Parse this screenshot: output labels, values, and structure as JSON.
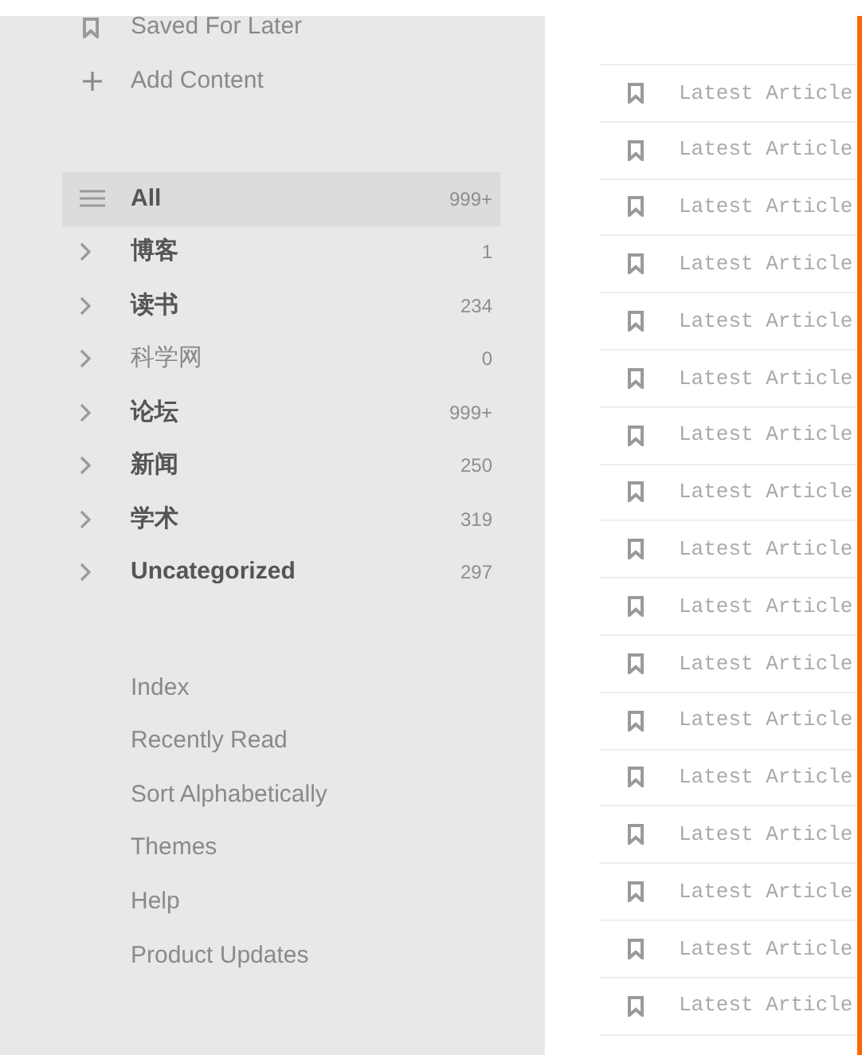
{
  "sidebar": {
    "top_items": [
      {
        "kind": "bookmark",
        "label": "Saved For Later"
      },
      {
        "kind": "add",
        "label": "Add Content"
      }
    ],
    "categories": [
      {
        "kind": "all",
        "label": "All",
        "count": "999+",
        "selected": true,
        "unread": true
      },
      {
        "kind": "folder",
        "label": "博客",
        "count": "1",
        "selected": false,
        "unread": true
      },
      {
        "kind": "folder",
        "label": "读书",
        "count": "234",
        "selected": false,
        "unread": true
      },
      {
        "kind": "folder",
        "label": "科学网",
        "count": "0",
        "selected": false,
        "unread": false
      },
      {
        "kind": "folder",
        "label": "论坛",
        "count": "999+",
        "selected": false,
        "unread": true
      },
      {
        "kind": "folder",
        "label": "新闻",
        "count": "250",
        "selected": false,
        "unread": true
      },
      {
        "kind": "folder",
        "label": "学术",
        "count": "319",
        "selected": false,
        "unread": true
      },
      {
        "kind": "folder",
        "label": "Uncategorized",
        "count": "297",
        "selected": false,
        "unread": true
      }
    ],
    "links": [
      "Index",
      "Recently Read",
      "Sort Alphabetically",
      "Themes",
      "Help",
      "Product Updates"
    ]
  },
  "articles": [
    {
      "title": "Latest Article"
    },
    {
      "title": "Latest Article"
    },
    {
      "title": "Latest Article"
    },
    {
      "title": "Latest Article"
    },
    {
      "title": "Latest Article"
    },
    {
      "title": "Latest Article"
    },
    {
      "title": "Latest Article"
    },
    {
      "title": "Latest Article"
    },
    {
      "title": "Latest Article"
    },
    {
      "title": "Latest Article"
    },
    {
      "title": "Latest Article"
    },
    {
      "title": "Latest Article"
    },
    {
      "title": "Latest Article"
    },
    {
      "title": "Latest Article"
    },
    {
      "title": "Latest Article"
    },
    {
      "title": "Latest Article"
    },
    {
      "title": "Latest Article"
    }
  ]
}
